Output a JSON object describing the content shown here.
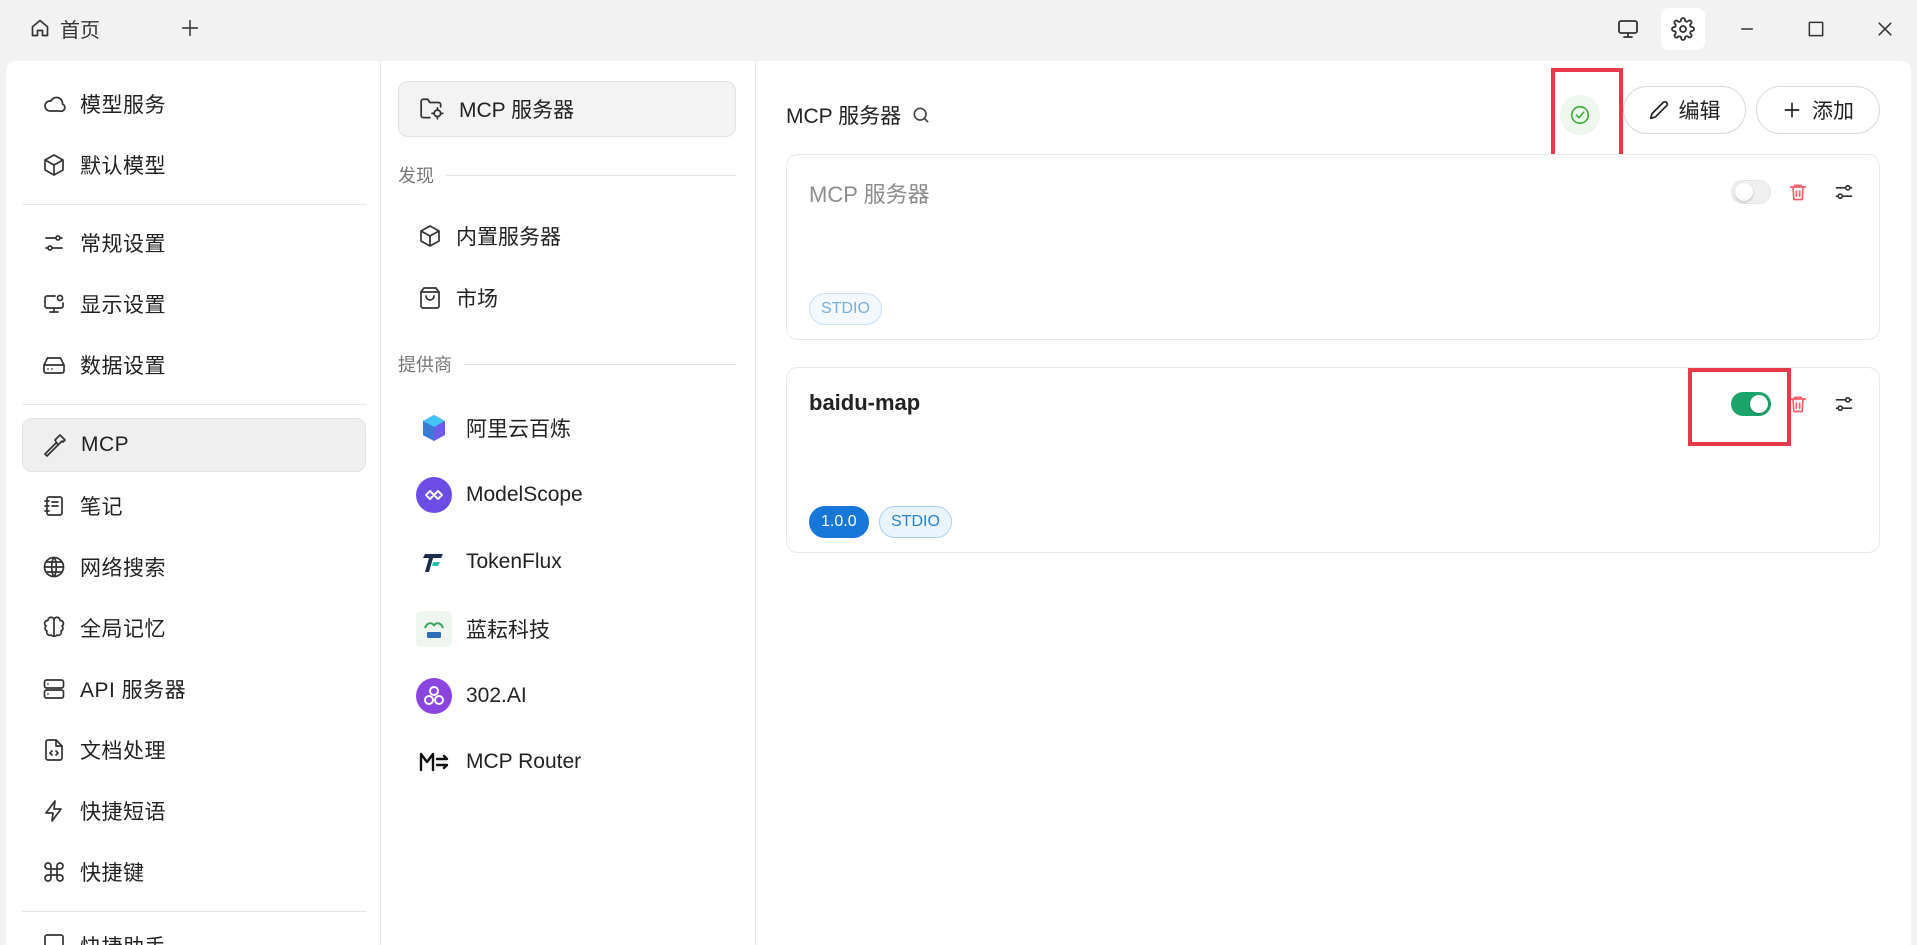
{
  "titlebar": {
    "home_tab_label": "首页"
  },
  "sidebar": {
    "items": [
      {
        "label": "模型服务"
      },
      {
        "label": "默认模型"
      },
      {
        "label": "常规设置"
      },
      {
        "label": "显示设置"
      },
      {
        "label": "数据设置"
      },
      {
        "label": "MCP"
      },
      {
        "label": "笔记"
      },
      {
        "label": "网络搜索"
      },
      {
        "label": "全局记忆"
      },
      {
        "label": "API 服务器"
      },
      {
        "label": "文档处理"
      },
      {
        "label": "快捷短语"
      },
      {
        "label": "快捷键"
      },
      {
        "label": "快捷助手"
      }
    ],
    "active_item": "MCP"
  },
  "midcol": {
    "top_label": "MCP 服务器",
    "discover_heading": "发现",
    "discover_items": [
      {
        "label": "内置服务器"
      },
      {
        "label": "市场"
      }
    ],
    "providers_heading": "提供商",
    "providers": [
      {
        "label": "阿里云百炼"
      },
      {
        "label": "ModelScope"
      },
      {
        "label": "TokenFlux"
      },
      {
        "label": "蓝耘科技"
      },
      {
        "label": "302.AI"
      },
      {
        "label": "MCP Router"
      }
    ]
  },
  "content": {
    "title": "MCP 服务器",
    "edit_label": "编辑",
    "add_label": "添加",
    "servers": [
      {
        "name": "MCP 服务器",
        "enabled": false,
        "tags": [
          "STDIO"
        ]
      },
      {
        "name": "baidu-map",
        "enabled": true,
        "version": "1.0.0",
        "tags": [
          "STDIO"
        ]
      }
    ]
  },
  "colors": {
    "accent_green": "#1aa36a",
    "highlight_red": "#e8394b",
    "tag_blue": "#1677d9",
    "delete_red": "#f5606a"
  }
}
